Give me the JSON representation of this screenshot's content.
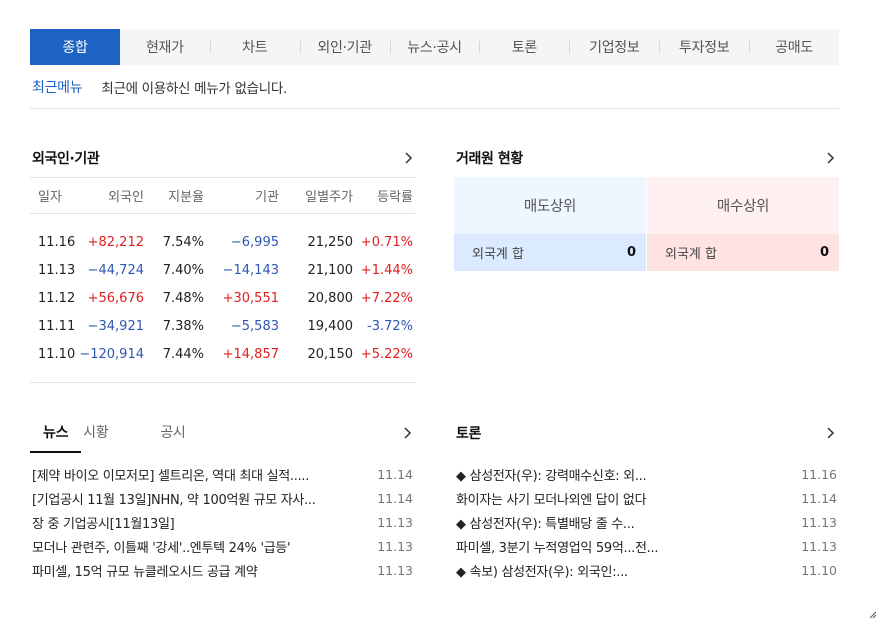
{
  "tabs": [
    "종합",
    "현재가",
    "차트",
    "외인·기관",
    "뉴스·공시",
    "토론",
    "기업정보",
    "투자정보",
    "공매도"
  ],
  "recent": {
    "label": "최근메뉴",
    "text": "최근에 이용하신 메뉴가 없습니다."
  },
  "investor": {
    "title": "외국인·기관",
    "headers": [
      "일자",
      "외국인",
      "지분율",
      "기관",
      "일별주가",
      "등락률"
    ],
    "rows": [
      {
        "date": "11.16",
        "foreign": "+82,212",
        "ratio": "7.54%",
        "inst": "−6,995",
        "price": "21,250",
        "change": "+0.71%"
      },
      {
        "date": "11.13",
        "foreign": "−44,724",
        "ratio": "7.40%",
        "inst": "−14,143",
        "price": "21,100",
        "change": "+1.44%"
      },
      {
        "date": "11.12",
        "foreign": "+56,676",
        "ratio": "7.48%",
        "inst": "+30,551",
        "price": "20,800",
        "change": "+7.22%"
      },
      {
        "date": "11.11",
        "foreign": "−34,921",
        "ratio": "7.38%",
        "inst": "−5,583",
        "price": "19,400",
        "change": "-3.72%"
      },
      {
        "date": "11.10",
        "foreign": "−120,914",
        "ratio": "7.44%",
        "inst": "+14,857",
        "price": "20,150",
        "change": "+5.22%"
      }
    ]
  },
  "broker": {
    "title": "거래원 현황",
    "sell_label": "매도상위",
    "buy_label": "매수상위",
    "sell_sum_label": "외국계 합",
    "sell_sum_value": "0",
    "buy_sum_label": "외국계 합",
    "buy_sum_value": "0"
  },
  "news": {
    "tabs": [
      "뉴스",
      "시황",
      "공시"
    ],
    "items": [
      {
        "title": "[제약 바이오 이모저모] 셀트리온, 역대 최대 실적.....",
        "date": "11.14"
      },
      {
        "title": "[기업공시 11월 13일]NHN, 약 100억원 규모 자사...",
        "date": "11.14"
      },
      {
        "title": "장 중 기업공시[11월13일]",
        "date": "11.13"
      },
      {
        "title": "모더나 관련주, 이틀째 '강세'..엔투텍 24% '급등'",
        "date": "11.13"
      },
      {
        "title": "파미셀, 15억 규모 뉴클레오시드 공급 계약",
        "date": "11.13"
      }
    ]
  },
  "discussion": {
    "title": "토론",
    "items": [
      {
        "title": "◆ 삼성전자(우): 강력매수신호: 외...",
        "date": "11.16"
      },
      {
        "title": "화이자는 사기 모더나외엔 답이 없다",
        "date": "11.14"
      },
      {
        "title": "◆ 삼성전자(우): 특별배당 줄 수...",
        "date": "11.13"
      },
      {
        "title": "파미셀, 3분기 누적영업익 59억...전...",
        "date": "11.13"
      },
      {
        "title": "◆ 속보) 삼성전자(우): 외국인:...",
        "date": "11.10"
      }
    ]
  },
  "colors": {
    "accent": "#1d63c4",
    "up": "#e02020",
    "down": "#2f56b3"
  }
}
